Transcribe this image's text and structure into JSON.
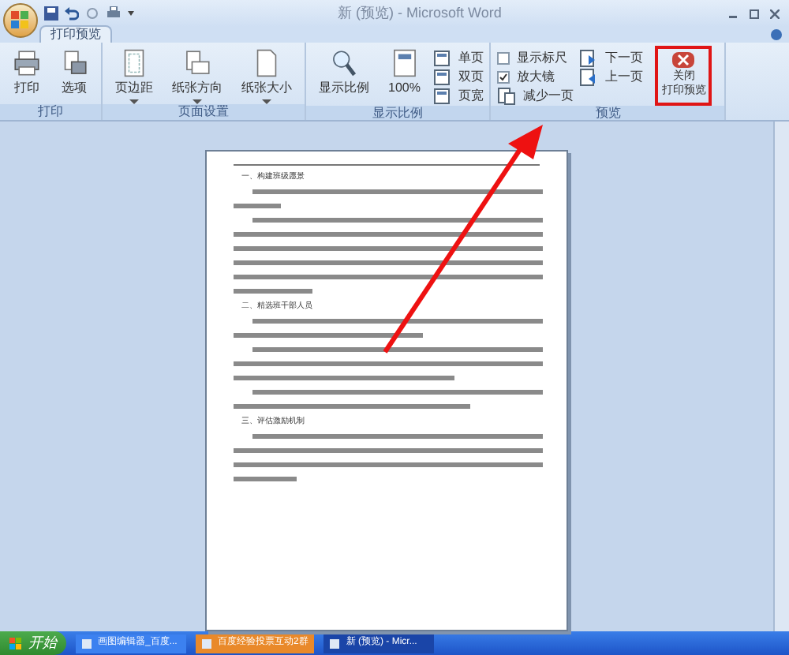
{
  "window": {
    "title": "新 (预览) - Microsoft Word"
  },
  "tabs": [
    {
      "label": "打印预览",
      "selected": true
    }
  ],
  "ribbon_groups": [
    {
      "label": "打印",
      "items": [
        {
          "kind": "big",
          "label": "打印"
        },
        {
          "kind": "big",
          "label": "选项"
        }
      ]
    },
    {
      "label": "页面设置",
      "items": [
        {
          "kind": "menu",
          "label": "页边距"
        },
        {
          "kind": "menu",
          "label": "纸张方向"
        },
        {
          "kind": "menu",
          "label": "纸张大小"
        }
      ]
    },
    {
      "label": "显示比例",
      "items": [
        {
          "kind": "big",
          "label": "显示比例"
        },
        {
          "kind": "big",
          "label": "100%"
        },
        {
          "kind": "small",
          "label": "单页"
        },
        {
          "kind": "small",
          "label": "双页"
        },
        {
          "kind": "small",
          "label": "页宽"
        }
      ]
    },
    {
      "label": "预览",
      "items": [
        {
          "kind": "check",
          "label": "显示标尺",
          "checked": false
        },
        {
          "kind": "check",
          "label": "放大镜",
          "checked": true
        },
        {
          "kind": "small",
          "label": "减少一页"
        },
        {
          "kind": "small",
          "label": "下一页"
        },
        {
          "kind": "small",
          "label": "上一页"
        },
        {
          "kind": "close",
          "label_lines": [
            "关闭",
            "打印预览"
          ]
        }
      ]
    }
  ],
  "document": {
    "headings": [
      "一、构建班级愿景",
      "二、精选班干部人员",
      "三、评估激励机制"
    ]
  },
  "taskbar": {
    "start": "开始",
    "items": [
      {
        "label": "画图编辑器_百度...",
        "selected": false
      },
      {
        "label": "百度经验投票互动2群",
        "selected": false
      },
      {
        "label": "新 (预览) - Micr...",
        "selected": true
      }
    ]
  }
}
